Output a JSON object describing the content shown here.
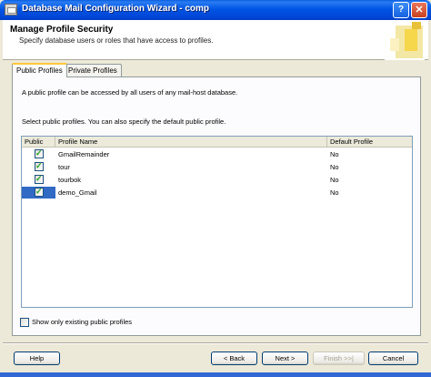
{
  "window": {
    "title": "Database Mail Configuration Wizard - comp"
  },
  "header": {
    "title": "Manage Profile Security",
    "subtitle": "Specify database users or roles that have access to profiles."
  },
  "tabs": [
    {
      "label": "Public Profiles",
      "active": true
    },
    {
      "label": "Private Profiles",
      "active": false
    }
  ],
  "panel": {
    "info": "A public profile can be accessed by all users of any mail-host database.",
    "instruction": "Select public profiles. You can also specify the default public profile."
  },
  "grid": {
    "columns": [
      "Public",
      "Profile Name",
      "Default Profile"
    ],
    "rows": [
      {
        "public": true,
        "name": "GmailRemainder",
        "default": "No"
      },
      {
        "public": true,
        "name": "tour",
        "default": "No"
      },
      {
        "public": true,
        "name": "tourbok",
        "default": "No"
      },
      {
        "public": true,
        "name": "demo_Gmail",
        "default": "No"
      }
    ]
  },
  "only_existing_label": "Show only existing public profiles",
  "buttons": {
    "help": "Help",
    "back": "< Back",
    "next": "Next >",
    "finish": "Finish >>|",
    "cancel": "Cancel"
  },
  "colors": {
    "titlebar": "#0055e5",
    "selection": "#316ac5",
    "accent_tab": "#ffc83c"
  }
}
